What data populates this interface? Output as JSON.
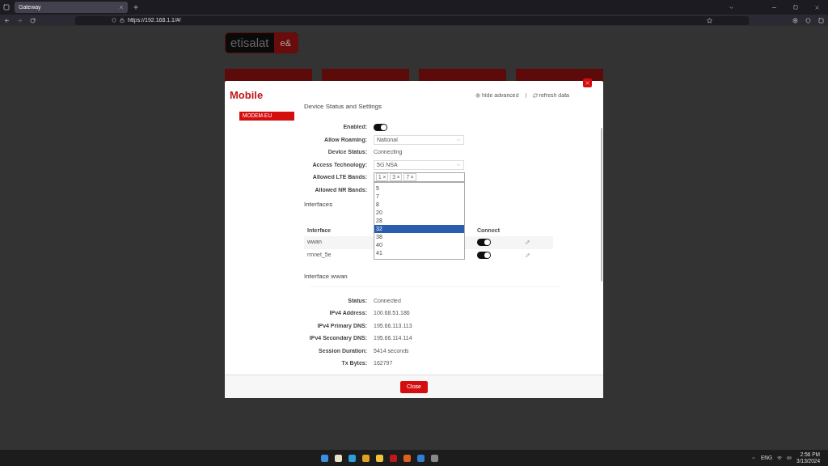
{
  "browser": {
    "tab_title": "Gateway",
    "url": "https://192.168.1.1/#/"
  },
  "page": {
    "logo_text": "etisalat",
    "logo_mark": "e&"
  },
  "modal": {
    "title": "Mobile",
    "links": [
      "hide advanced",
      "refresh data"
    ],
    "sidebar": [
      {
        "label": "MODEM-EU",
        "selected": true
      }
    ],
    "section_title": "Device Status and Settings",
    "fields": [
      {
        "label": "Enabled:",
        "kind": "toggle",
        "on": true
      },
      {
        "label": "Allow Roaming:",
        "kind": "select",
        "value": "National"
      },
      {
        "label": "Device Status:",
        "kind": "text",
        "value": "Connecting"
      },
      {
        "label": "Access Technology:",
        "kind": "select",
        "value": "5G NSA"
      },
      {
        "label": "Allowed LTE Bands:",
        "kind": "chips",
        "chips": [
          "1 ×",
          "3 ×",
          "7 ×"
        ]
      },
      {
        "label": "Allowed NR Bands:",
        "kind": "empty"
      }
    ],
    "dropdown": [
      {
        "label": "5",
        "selected": false
      },
      {
        "label": "7",
        "selected": false
      },
      {
        "label": "8",
        "selected": false
      },
      {
        "label": "20",
        "selected": false
      },
      {
        "label": "28",
        "selected": false
      },
      {
        "label": "32",
        "selected": true
      },
      {
        "label": "38",
        "selected": false
      },
      {
        "label": "40",
        "selected": false
      },
      {
        "label": "41",
        "selected": false
      }
    ],
    "interfaces_title": "Interfaces",
    "columns": [
      "Interface",
      "Connect"
    ],
    "rows": [
      {
        "name": "wwan",
        "connected": true
      },
      {
        "name": "rmnet_5e",
        "connected": true
      }
    ],
    "details_title": "Interface wwan",
    "details": [
      {
        "label": "Status:",
        "value": "Connected"
      },
      {
        "label": "IPv4 Address:",
        "value": "100.68.51.186"
      },
      {
        "label": "IPv4 Primary DNS:",
        "value": "195.66.113.113"
      },
      {
        "label": "IPv4 Secondary DNS:",
        "value": "195.66.114.114"
      },
      {
        "label": "Session Duration:",
        "value": "5414 seconds"
      },
      {
        "label": "Tx Bytes:",
        "value": "162797"
      }
    ],
    "close_button": "Close"
  },
  "taskbar": {
    "language": "ENG",
    "time": "2:56 PM",
    "date": "3/13/2024"
  }
}
